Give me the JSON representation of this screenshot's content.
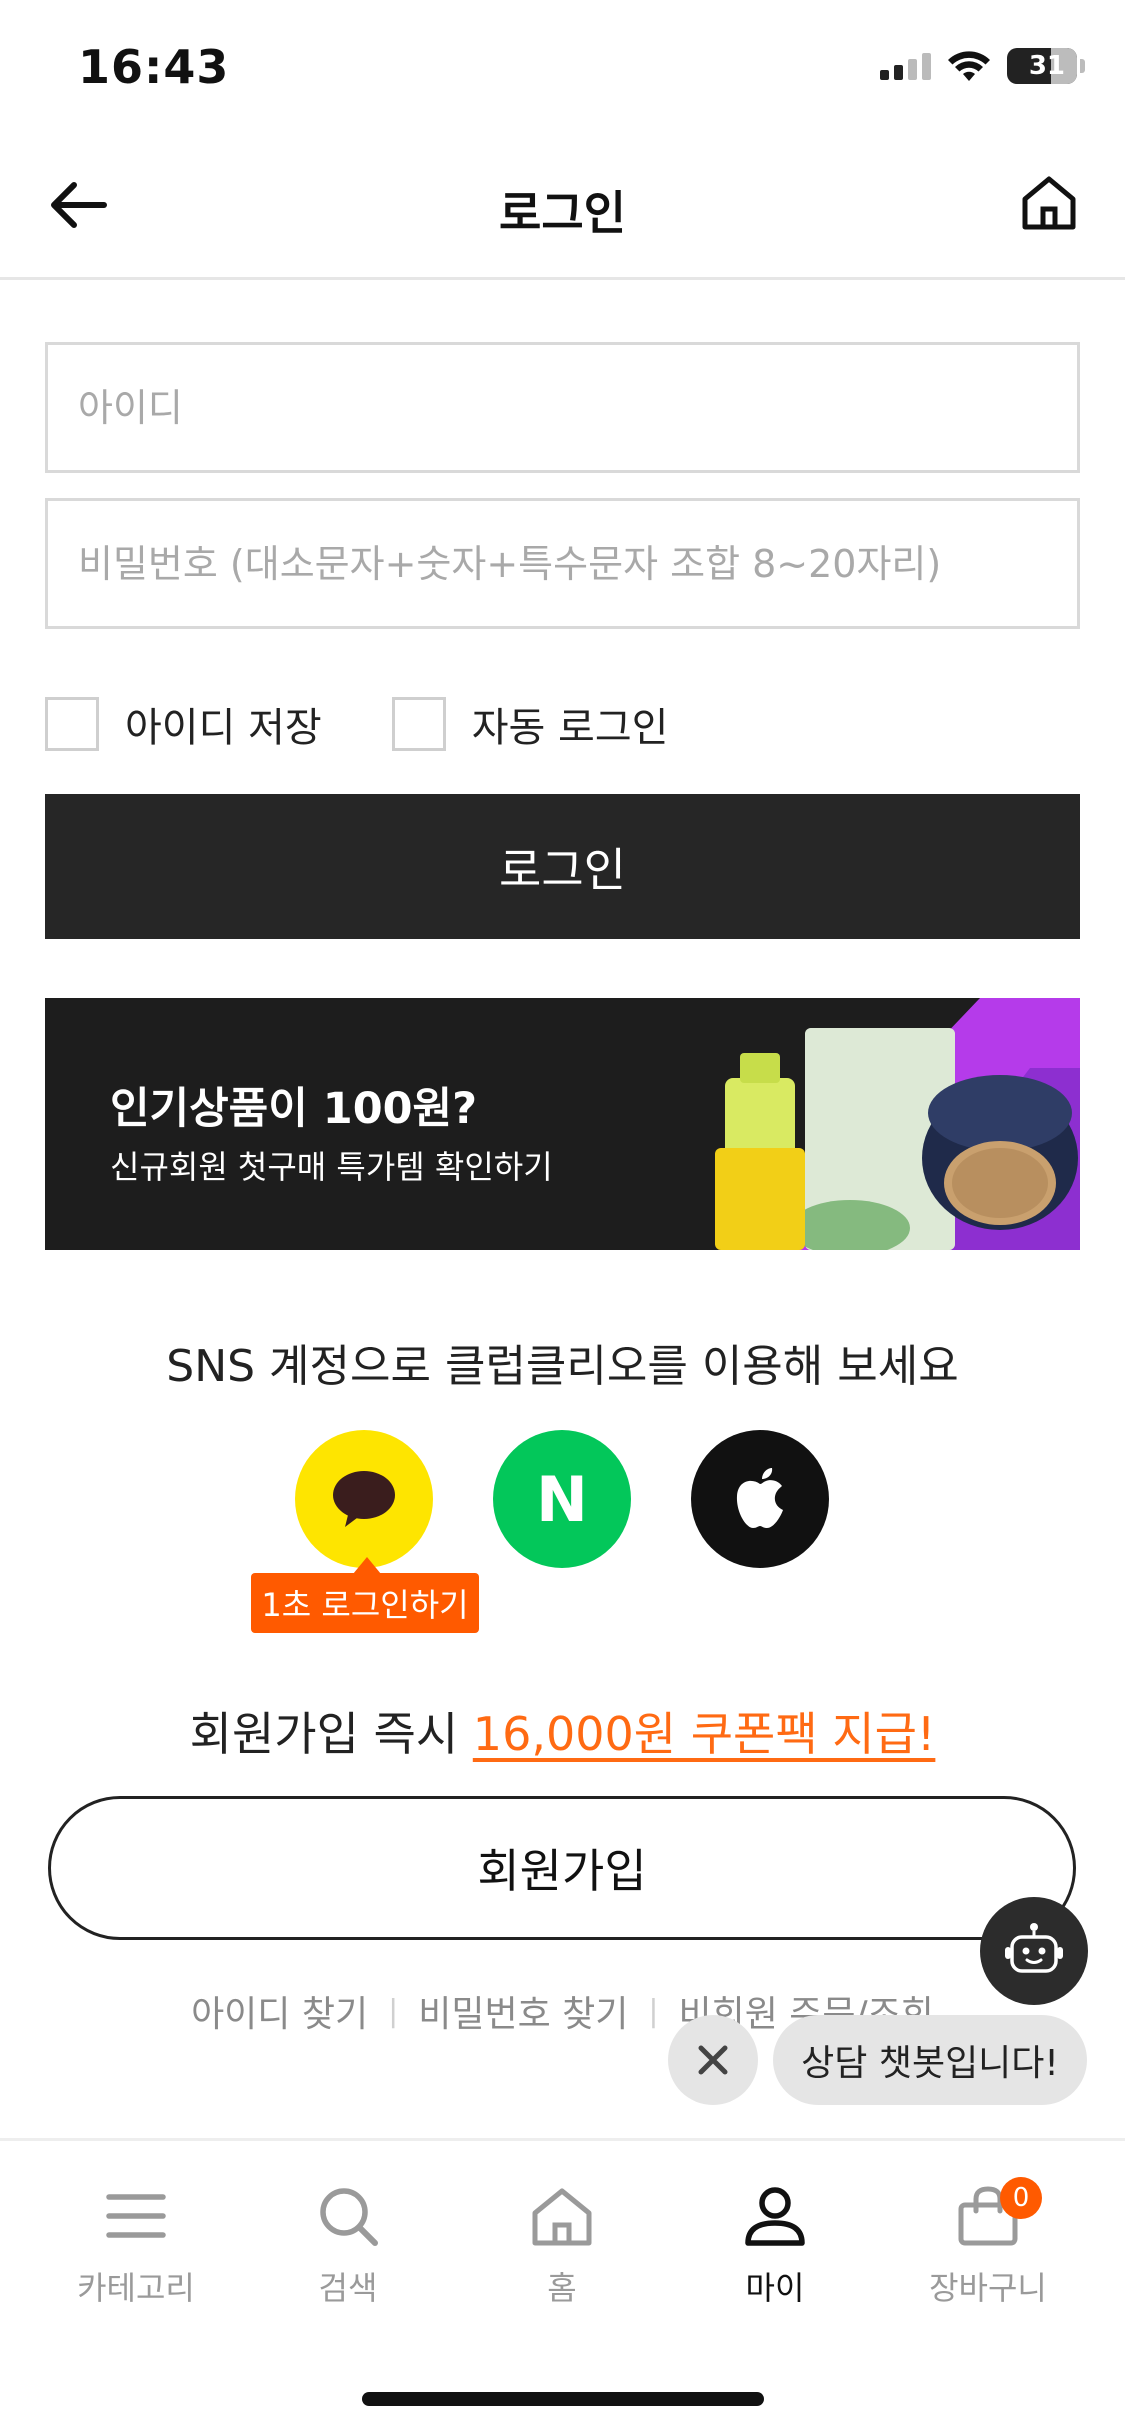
{
  "status_bar": {
    "time": "16:43",
    "battery": "31"
  },
  "header": {
    "title": "로그인"
  },
  "form": {
    "id_placeholder": "아이디",
    "password_placeholder": "비밀번호 (대소문자+숫자+특수문자 조합 8~20자리)",
    "save_id_label": "아이디 저장",
    "auto_login_label": "자동 로그인",
    "login_button": "로그인"
  },
  "banner": {
    "title": "인기상품이 100원?",
    "subtitle": "신규회원 첫구매 특가템 확인하기",
    "colors": {
      "background": "#1d1d1d",
      "accent": "#b53bea"
    }
  },
  "sns": {
    "title": "SNS 계정으로 클럽클리오를 이용해 보세요",
    "buttons": [
      {
        "name": "kakao-icon",
        "color": "#fee500"
      },
      {
        "name": "naver-icon",
        "label": "N",
        "color": "#03c75a"
      },
      {
        "name": "apple-icon",
        "color": "#111111"
      }
    ],
    "tooltip": "1초 로그인하기"
  },
  "signup": {
    "promo_prefix": "회원가입 즉시 ",
    "promo_highlight": "16,000원 쿠폰팩 지급!",
    "button": "회원가입"
  },
  "links": {
    "find_id": "아이디 찾기",
    "find_password": "비밀번호 찾기",
    "guest_order": "비회원 주문/조회"
  },
  "chatbot": {
    "bubble": "상담 챗봇입니다!"
  },
  "nav": {
    "items": [
      {
        "label": "카테고리",
        "icon": "menu-icon"
      },
      {
        "label": "검색",
        "icon": "search-icon"
      },
      {
        "label": "홈",
        "icon": "home-icon"
      },
      {
        "label": "마이",
        "icon": "person-icon",
        "active": true
      },
      {
        "label": "장바구니",
        "icon": "bag-icon",
        "badge": "0"
      }
    ]
  },
  "colors": {
    "accent": "#ff5a00",
    "dark": "#262626"
  }
}
